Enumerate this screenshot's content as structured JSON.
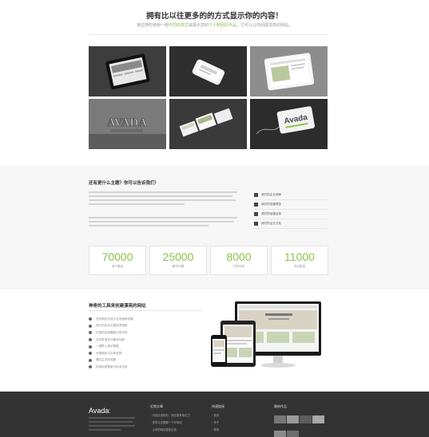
{
  "hero": {
    "title": "拥有比以往更多的的方式显示你的内容！",
    "subtitle_prefix": "通过随时使用一组",
    "subtitle_link1": "不同的样式",
    "subtitle_mid": "来展示您的",
    "subtitle_link2": "个人和团队作品",
    "subtitle_suffix": "，它可以让你创建漂亮的网站。"
  },
  "gallery": {
    "items": [
      {
        "label": "ipad-mockup"
      },
      {
        "label": "iphone-mockup"
      },
      {
        "label": "tablet-mockup"
      },
      {
        "label": "avada-stone"
      },
      {
        "label": "brochure-pages"
      },
      {
        "label": "avada-tag"
      }
    ],
    "stone_text": "AVADA",
    "tag_text": "Avada"
  },
  "features": {
    "title": "还有更什么主题？你可以告诉我们！",
    "list": [
      {
        "label": "我们的企业使命"
      },
      {
        "label": "我们的经营理念"
      },
      {
        "label": "我们的经营目标"
      },
      {
        "label": "我们的企业文化"
      }
    ]
  },
  "stats": [
    {
      "value": "70000",
      "label": "用户数量"
    },
    {
      "value": "25000",
      "label": "解决问题"
    },
    {
      "value": "8000",
      "label": "开发时间"
    },
    {
      "value": "11000",
      "label": "项目数量"
    }
  ],
  "tools": {
    "title": "神奇的工具来创建漂亮的网站",
    "items": [
      {
        "label": "完全响应式设计支持各种设备"
      },
      {
        "label": "强大的后台主题选项面板"
      },
      {
        "label": "丰富的页面模板与短代码"
      },
      {
        "label": "支持多语言与翻译功能"
      },
      {
        "label": "一键导入演示数据"
      },
      {
        "label": "无限颜色与字体选择"
      },
      {
        "label": "兼容主流浏览器"
      },
      {
        "label": "持续免费更新与技术支持"
      }
    ]
  },
  "footer": {
    "logo": "Avada",
    "logo_dot": ":",
    "col1": {
      "title": "近期文章",
      "items": [
        "内容应该精彩，而且更有吸引力",
        "您的业务需要一个好网站",
        "让你的网站更加出色"
      ]
    },
    "col2": {
      "title": "快速链接",
      "items": [
        "首页",
        "关于",
        "联系"
      ]
    },
    "col3": {
      "title": "最新作品"
    }
  },
  "colors": {
    "accent": "#8bc34a",
    "footer_bg": "#333333",
    "section_bg": "#f6f6f6"
  }
}
